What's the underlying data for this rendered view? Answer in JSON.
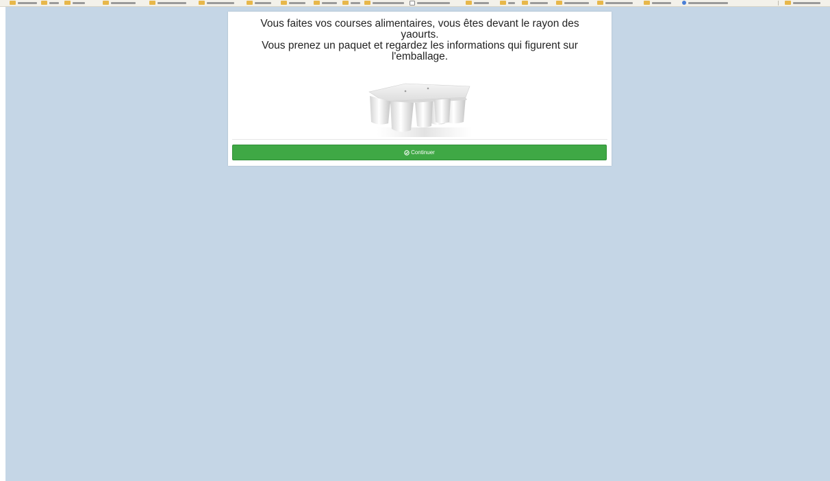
{
  "browser": {
    "bookmark_bar_color": "#f3f1ea",
    "folder_icon_color": "#e7b74a"
  },
  "page": {
    "background_color": "#c5d6e6"
  },
  "question": {
    "lines": [
      "Vous faites vos courses alimentaires, vous êtes devant le rayon des",
      "yaourts.",
      "Vous prenez un paquet et regardez les informations qui figurent sur",
      "l'emballage."
    ]
  },
  "image": {
    "subject": "yogurt-pack-icon"
  },
  "actions": {
    "continue_label": "Continuer",
    "continue_icon": "check-circle-icon",
    "continue_color": "#3fa845"
  }
}
